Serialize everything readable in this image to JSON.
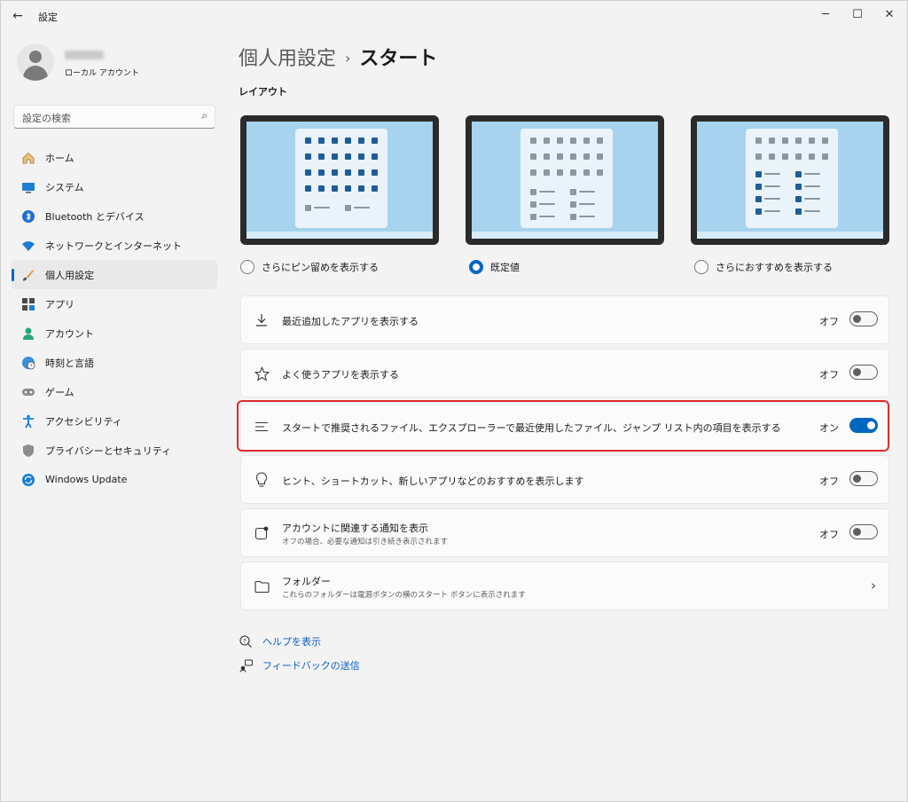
{
  "titlebar": {
    "title": "設定",
    "back_glyph": "←",
    "minimize_glyph": "─",
    "maximize_glyph": "☐",
    "close_glyph": "✕"
  },
  "profile": {
    "account_type": "ローカル アカウント"
  },
  "search": {
    "placeholder": "設定の検索",
    "icon": "search-icon"
  },
  "sidebar": {
    "items": [
      {
        "label": "ホーム",
        "icon": "home-icon"
      },
      {
        "label": "システム",
        "icon": "system-icon"
      },
      {
        "label": "Bluetooth とデバイス",
        "icon": "bluetooth-icon"
      },
      {
        "label": "ネットワークとインターネット",
        "icon": "wifi-icon"
      },
      {
        "label": "個人用設定",
        "icon": "brush-icon",
        "active": true
      },
      {
        "label": "アプリ",
        "icon": "apps-icon"
      },
      {
        "label": "アカウント",
        "icon": "account-icon"
      },
      {
        "label": "時刻と言語",
        "icon": "globe-clock-icon"
      },
      {
        "label": "ゲーム",
        "icon": "gamepad-icon"
      },
      {
        "label": "アクセシビリティ",
        "icon": "accessibility-icon"
      },
      {
        "label": "プライバシーとセキュリティ",
        "icon": "shield-icon"
      },
      {
        "label": "Windows Update",
        "icon": "update-icon"
      }
    ]
  },
  "breadcrumb": {
    "parent": "個人用設定",
    "separator": "›",
    "current": "スタート"
  },
  "layout": {
    "section_label": "レイアウト",
    "options": [
      {
        "label": "さらにピン留めを表示する",
        "selected": false
      },
      {
        "label": "既定値",
        "selected": true
      },
      {
        "label": "さらにおすすめを表示する",
        "selected": false
      }
    ]
  },
  "settings": [
    {
      "title": "最近追加したアプリを表示する",
      "state": "オフ",
      "on": false,
      "icon": "download-icon"
    },
    {
      "title": "よく使うアプリを表示する",
      "state": "オフ",
      "on": false,
      "icon": "star-icon"
    },
    {
      "title": "スタートで推奨されるファイル、エクスプローラーで最近使用したファイル、ジャンプ リスト内の項目を表示する",
      "state": "オン",
      "on": true,
      "icon": "list-icon"
    },
    {
      "title": "ヒント、ショートカット、新しいアプリなどのおすすめを表示します",
      "state": "オフ",
      "on": false,
      "icon": "lightbulb-icon"
    },
    {
      "title": "アカウントに関連する通知を表示",
      "subtitle": "オフの場合、必要な通知は引き続き表示されます",
      "state": "オフ",
      "on": false,
      "icon": "notification-icon"
    },
    {
      "title": "フォルダー",
      "subtitle": "これらのフォルダーは電源ボタンの横のスタート ボタンに表示されます",
      "icon": "folder-icon",
      "chevron": "›"
    }
  ],
  "links": {
    "help": "ヘルプを表示",
    "feedback": "フィードバックの送信"
  },
  "colors": {
    "accent": "#0067c0",
    "highlight_border": "#e02b2b",
    "tile_dark": "#1f5d99",
    "tile_grey": "#8b98a3"
  }
}
